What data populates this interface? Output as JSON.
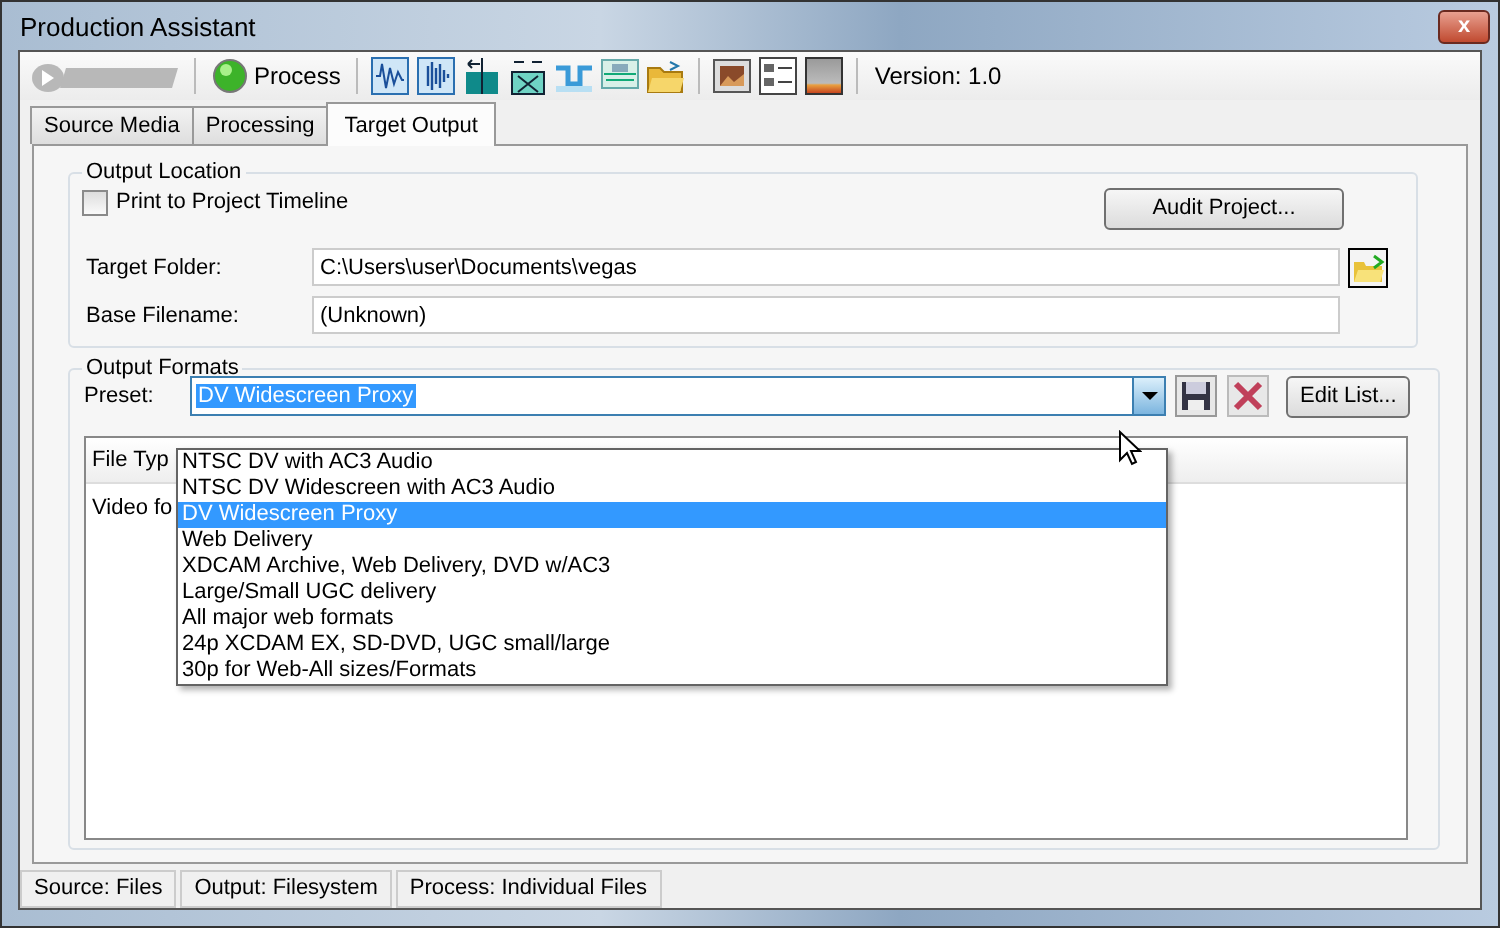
{
  "window": {
    "title": "Production Assistant",
    "close": "x"
  },
  "toolbar": {
    "process_label": "Process",
    "version": "Version: 1.0"
  },
  "tabs": [
    {
      "label": "Source Media",
      "selected": false
    },
    {
      "label": "Processing",
      "selected": false
    },
    {
      "label": "Target Output",
      "selected": true
    }
  ],
  "output_location": {
    "legend": "Output Location",
    "print_to_timeline": {
      "label": "Print to Project Timeline",
      "checked": false
    },
    "audit_button": "Audit Project...",
    "fields": [
      {
        "label": "Target Folder:",
        "value": "C:\\Users\\user\\Documents\\vegas"
      },
      {
        "label": "Base Filename:",
        "value": "(Unknown)"
      }
    ]
  },
  "output_formats": {
    "legend": "Output Formats",
    "preset_label": "Preset:",
    "preset_value": "DV Widescreen Proxy",
    "edit_button": "Edit List...",
    "dropdown": [
      {
        "label": "NTSC DV with AC3 Audio",
        "selected": false
      },
      {
        "label": "NTSC DV Widescreen with AC3 Audio",
        "selected": false
      },
      {
        "label": "DV Widescreen Proxy",
        "selected": true
      },
      {
        "label": "Web Delivery",
        "selected": false
      },
      {
        "label": "XDCAM Archive, Web Delivery, DVD w/AC3",
        "selected": false
      },
      {
        "label": "Large/Small UGC delivery",
        "selected": false
      },
      {
        "label": "All major web formats",
        "selected": false
      },
      {
        "label": "24p XCDAM EX, SD-DVD, UGC small/large",
        "selected": false
      },
      {
        "label": "30p for Web-All sizes/Formats",
        "selected": false
      }
    ],
    "list": {
      "columns": [
        "File Typ"
      ],
      "rows": [
        [
          "Video fo"
        ]
      ]
    }
  },
  "status_bar": [
    "Source: Files",
    "Output: Filesystem",
    "Process: Individual Files"
  ]
}
